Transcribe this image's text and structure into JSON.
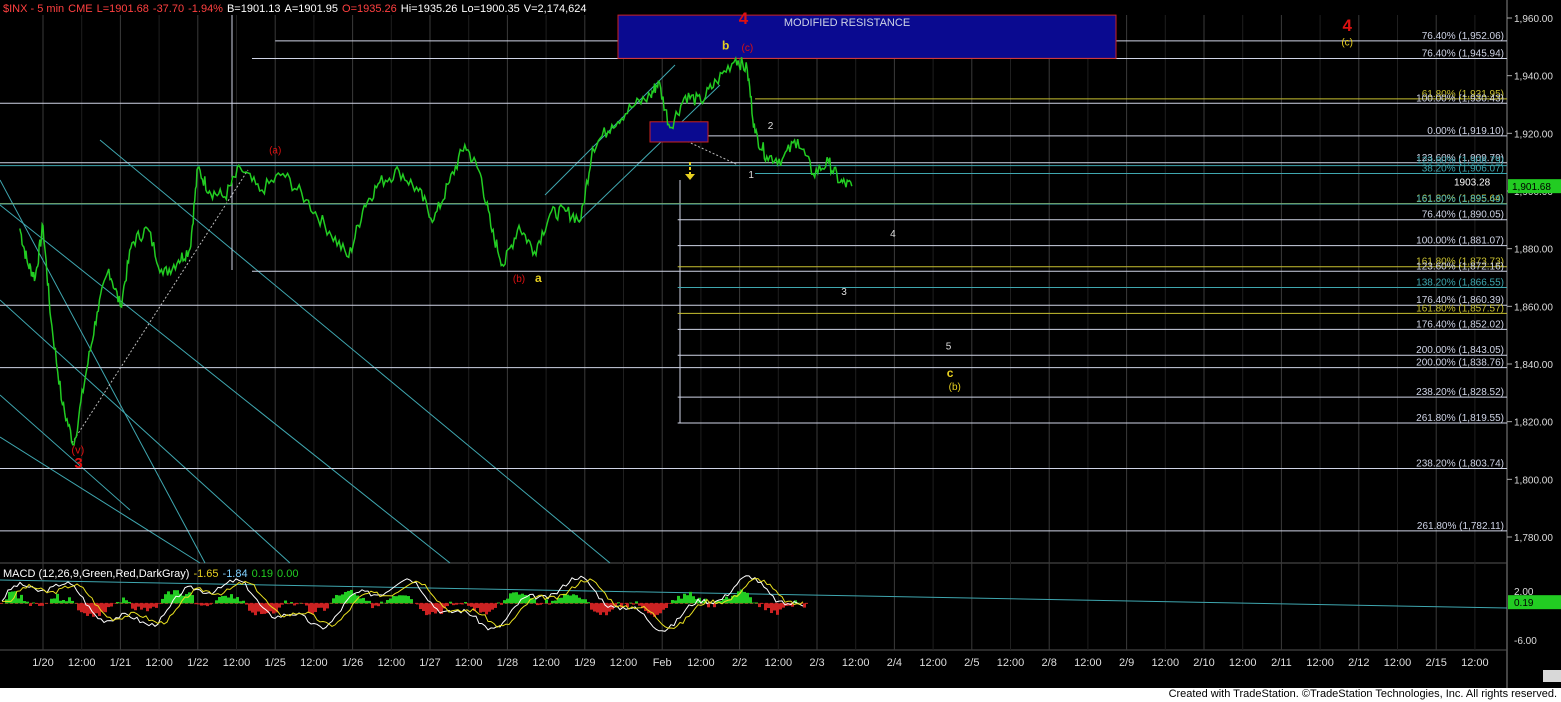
{
  "header": {
    "symbol": "$INX - 5 min",
    "exchange": "CME",
    "last": "L=1901.68",
    "change": "-37.70",
    "change_pct": "-1.94%",
    "bid": "B=1901.13",
    "ask": "A=1901.95",
    "open": "O=1935.26",
    "high": "Hi=1935.26",
    "low": "Lo=1900.35",
    "volume": "V=2,174,624"
  },
  "macd_header": {
    "title": "MACD (12,26,9,Green,Red,DarkGray)",
    "v1": "-1.65",
    "v2": "-1.84",
    "v3": "0.19",
    "v4": "0.00"
  },
  "footer": "Created with TradeStation. ©TradeStation Technologies, Inc. All rights reserved.",
  "colors": {
    "price": "#22cc22",
    "resistance_box": "#0a0a90",
    "resistance_border": "#cc2222",
    "fib_white": "#cfd4e6",
    "fib_yellow": "#c8c030",
    "fib_teal": "#3fa7b0",
    "label_red": "#dd1111",
    "label_yellow": "#e8d020",
    "macd_line": "#ffffff",
    "signal_line": "#e8e020",
    "price_box": "#22cc22"
  },
  "chart_data": {
    "type": "line",
    "title": "$INX - 5 min",
    "ylim": [
      1765,
      1965
    ],
    "y_ticks": [
      "1,960.00",
      "1,940.00",
      "1,920.00",
      "1,900.00",
      "1,880.00",
      "1,860.00",
      "1,840.00",
      "1,820.00",
      "1,800.00",
      "1,780.00"
    ],
    "y_tick_values": [
      1960,
      1940,
      1920,
      1900,
      1880,
      1860,
      1840,
      1820,
      1800,
      1780
    ],
    "x_ticks": [
      "1/20",
      "12:00",
      "1/21",
      "12:00",
      "1/22",
      "12:00",
      "1/25",
      "12:00",
      "1/26",
      "12:00",
      "1/27",
      "12:00",
      "1/28",
      "12:00",
      "1/29",
      "12:00",
      "Feb",
      "12:00",
      "2/2",
      "12:00",
      "2/3",
      "12:00",
      "2/4",
      "12:00",
      "2/5",
      "12:00",
      "2/8",
      "12:00",
      "2/9",
      "12:00",
      "2/10",
      "12:00",
      "2/11",
      "12:00",
      "2/12",
      "12:00",
      "2/15",
      "12:00"
    ],
    "x_tick_index": [
      0,
      0.5,
      1,
      1.5,
      2,
      2.5,
      3,
      3.5,
      4,
      4.5,
      5,
      5.5,
      6,
      6.5,
      7,
      7.5,
      8,
      8.5,
      9,
      9.5,
      10,
      10.5,
      11,
      11.5,
      12,
      12.5,
      13,
      13.5,
      14,
      14.5,
      15,
      15.5,
      16,
      16.5,
      17,
      17.5,
      18,
      18.5
    ],
    "x_axis_start": "1/20",
    "last_price": "1,901.68",
    "last_price_value": 1901.68,
    "price_keypoints": [
      {
        "x": -0.3,
        "y": 1887
      },
      {
        "x": -0.2,
        "y": 1875
      },
      {
        "x": -0.1,
        "y": 1870
      },
      {
        "x": 0.0,
        "y": 1888
      },
      {
        "x": 0.1,
        "y": 1856
      },
      {
        "x": 0.25,
        "y": 1826
      },
      {
        "x": 0.4,
        "y": 1812
      },
      {
        "x": 0.55,
        "y": 1836
      },
      {
        "x": 0.7,
        "y": 1858
      },
      {
        "x": 0.85,
        "y": 1873
      },
      {
        "x": 1.0,
        "y": 1860
      },
      {
        "x": 1.15,
        "y": 1882
      },
      {
        "x": 1.35,
        "y": 1887
      },
      {
        "x": 1.55,
        "y": 1871
      },
      {
        "x": 1.75,
        "y": 1876
      },
      {
        "x": 1.9,
        "y": 1880
      },
      {
        "x": 2.0,
        "y": 1908
      },
      {
        "x": 2.15,
        "y": 1900
      },
      {
        "x": 2.35,
        "y": 1898
      },
      {
        "x": 2.55,
        "y": 1908
      },
      {
        "x": 2.8,
        "y": 1900
      },
      {
        "x": 3.1,
        "y": 1906
      },
      {
        "x": 3.4,
        "y": 1897
      },
      {
        "x": 3.7,
        "y": 1886
      },
      {
        "x": 3.95,
        "y": 1877
      },
      {
        "x": 4.15,
        "y": 1895
      },
      {
        "x": 4.35,
        "y": 1903
      },
      {
        "x": 4.6,
        "y": 1907
      },
      {
        "x": 4.85,
        "y": 1900
      },
      {
        "x": 5.05,
        "y": 1890
      },
      {
        "x": 5.25,
        "y": 1903
      },
      {
        "x": 5.45,
        "y": 1916
      },
      {
        "x": 5.65,
        "y": 1906
      },
      {
        "x": 5.8,
        "y": 1886
      },
      {
        "x": 5.95,
        "y": 1874
      },
      {
        "x": 6.15,
        "y": 1888
      },
      {
        "x": 6.35,
        "y": 1879
      },
      {
        "x": 6.55,
        "y": 1892
      },
      {
        "x": 6.75,
        "y": 1893
      },
      {
        "x": 6.95,
        "y": 1890
      },
      {
        "x": 7.1,
        "y": 1915
      },
      {
        "x": 7.35,
        "y": 1923
      },
      {
        "x": 7.6,
        "y": 1929
      },
      {
        "x": 7.85,
        "y": 1933
      },
      {
        "x": 7.95,
        "y": 1938
      },
      {
        "x": 8.1,
        "y": 1922
      },
      {
        "x": 8.3,
        "y": 1933
      },
      {
        "x": 8.5,
        "y": 1931
      },
      {
        "x": 8.7,
        "y": 1938
      },
      {
        "x": 8.95,
        "y": 1946
      },
      {
        "x": 9.1,
        "y": 1942
      },
      {
        "x": 9.2,
        "y": 1920
      },
      {
        "x": 9.35,
        "y": 1912
      },
      {
        "x": 9.55,
        "y": 1911
      },
      {
        "x": 9.75,
        "y": 1918
      },
      {
        "x": 9.95,
        "y": 1906
      },
      {
        "x": 10.15,
        "y": 1910
      },
      {
        "x": 10.3,
        "y": 1903
      },
      {
        "x": 10.45,
        "y": 1901.68
      }
    ],
    "fib_levels": [
      {
        "label": "76.40% (1,952.06)",
        "value": 1952.06,
        "color": "white",
        "x_start": 3.0
      },
      {
        "label": "76.40% (1,945.94)",
        "value": 1945.94,
        "color": "white",
        "x_start": 2.7
      },
      {
        "label": "61.80% (1,931.95)",
        "value": 1931.95,
        "color": "yellow",
        "x_start": 9.2
      },
      {
        "label": "100.00% (1,930.43)",
        "value": 1930.43,
        "color": "white",
        "x_start": -1
      },
      {
        "label": "0.00% (1,919.10)",
        "value": 1919.1,
        "color": "white",
        "x_start": 8.0
      },
      {
        "label": "123.60% (1,909.79)",
        "value": 1909.79,
        "color": "white",
        "x_start": -1
      },
      {
        "label": "123.60% (1,908.79)",
        "value": 1908.79,
        "color": "teal",
        "x_start": -1
      },
      {
        "label": "38.20% (1,906.07)",
        "value": 1906.07,
        "color": "teal",
        "x_start": 9.2
      },
      {
        "label": "161.80% (1,895.64)",
        "value": 1895.64,
        "color": "yellow",
        "x_start": -1
      },
      {
        "label": "161.80% (1,895.49)",
        "value": 1895.49,
        "color": "teal",
        "x_start": -1
      },
      {
        "label": "76.40% (1,890.05)",
        "value": 1890.05,
        "color": "white",
        "x_start": 8.2
      },
      {
        "label": "100.00% (1,881.07)",
        "value": 1881.07,
        "color": "white",
        "x_start": 8.2
      },
      {
        "label": "161.80% (1,873.73)",
        "value": 1873.73,
        "color": "yellow",
        "x_start": 8.2
      },
      {
        "label": "123.60% (1,872.16)",
        "value": 1872.16,
        "color": "white",
        "x_start": 2.7
      },
      {
        "label": "138.20% (1,866.55)",
        "value": 1866.55,
        "color": "teal",
        "x_start": 8.2
      },
      {
        "label": "176.40% (1,860.39)",
        "value": 1860.39,
        "color": "white",
        "x_start": -1
      },
      {
        "label": "161.80% (1,857.57)",
        "value": 1857.57,
        "color": "yellow",
        "x_start": 8.2
      },
      {
        "label": "176.40% (1,852.02)",
        "value": 1852.02,
        "color": "white",
        "x_start": 8.2
      },
      {
        "label": "200.00% (1,843.05)",
        "value": 1843.05,
        "color": "white",
        "x_start": 8.2
      },
      {
        "label": "200.00% (1,838.76)",
        "value": 1838.76,
        "color": "white",
        "x_start": -1
      },
      {
        "label": "238.20% (1,828.52)",
        "value": 1828.52,
        "color": "white",
        "x_start": 8.2
      },
      {
        "label": "261.80% (1,819.55)",
        "value": 1819.55,
        "color": "white",
        "x_start": 8.2
      },
      {
        "label": "238.20% (1,803.74)",
        "value": 1803.74,
        "color": "white",
        "x_start": -1
      },
      {
        "label": "261.80% (1,782.11)",
        "value": 1782.11,
        "color": "white",
        "x_start": -1
      }
    ],
    "resistance_zone": {
      "label": "MODIFIED RESISTANCE",
      "x0": 7.55,
      "x1": 13.6,
      "y0": 1946,
      "y1": 1961
    },
    "support_box": {
      "x0": 7.95,
      "x1": 8.65,
      "y0": 1917,
      "y1": 1924
    },
    "price_box_value": "1903.28",
    "wave_labels": [
      {
        "text": "4",
        "x": 9.05,
        "y": 1958,
        "color": "red",
        "size": 17
      },
      {
        "text": "b",
        "x": 8.82,
        "y": 1949,
        "color": "yellow",
        "size": 12
      },
      {
        "text": "(c)",
        "x": 9.1,
        "y": 1948.5,
        "color": "red",
        "size": 10
      },
      {
        "text": "4",
        "x": 16.85,
        "y": 1955.5,
        "color": "red",
        "size": 17
      },
      {
        "text": "(c)",
        "x": 16.85,
        "y": 1950.5,
        "color": "yellow",
        "size": 10
      },
      {
        "text": "2",
        "x": 9.4,
        "y": 1921.5,
        "color": "white",
        "size": 10
      },
      {
        "text": "1",
        "x": 9.15,
        "y": 1904.5,
        "color": "white",
        "size": 10
      },
      {
        "text": "(a)",
        "x": 3.0,
        "y": 1913,
        "color": "red",
        "size": 10
      },
      {
        "text": "(b)",
        "x": 6.15,
        "y": 1868.5,
        "color": "red",
        "size": 10
      },
      {
        "text": "a",
        "x": 6.4,
        "y": 1868.5,
        "color": "yellow",
        "size": 12
      },
      {
        "text": "4",
        "x": 10.98,
        "y": 1884,
        "color": "white",
        "size": 10
      },
      {
        "text": "3",
        "x": 10.35,
        "y": 1864,
        "color": "white",
        "size": 10
      },
      {
        "text": "5",
        "x": 11.7,
        "y": 1845,
        "color": "white",
        "size": 10
      },
      {
        "text": "c",
        "x": 11.72,
        "y": 1835.5,
        "color": "yellow",
        "size": 12
      },
      {
        "text": "(b)",
        "x": 11.78,
        "y": 1831,
        "color": "yellow",
        "size": 10
      },
      {
        "text": "(v)",
        "x": 0.45,
        "y": 1809,
        "color": "red",
        "size": 11
      },
      {
        "text": "3",
        "x": 0.46,
        "y": 1804,
        "color": "red",
        "size": 15
      }
    ],
    "macd": {
      "title": "MACD (12,26,9,Green,Red,DarkGray)",
      "values": [
        -1.65,
        -1.84,
        0.19,
        0.0
      ],
      "y_ticks": [
        "2.00",
        "0.19",
        "-6.00"
      ],
      "y_tick_values": [
        2,
        0.19,
        -6
      ]
    }
  }
}
